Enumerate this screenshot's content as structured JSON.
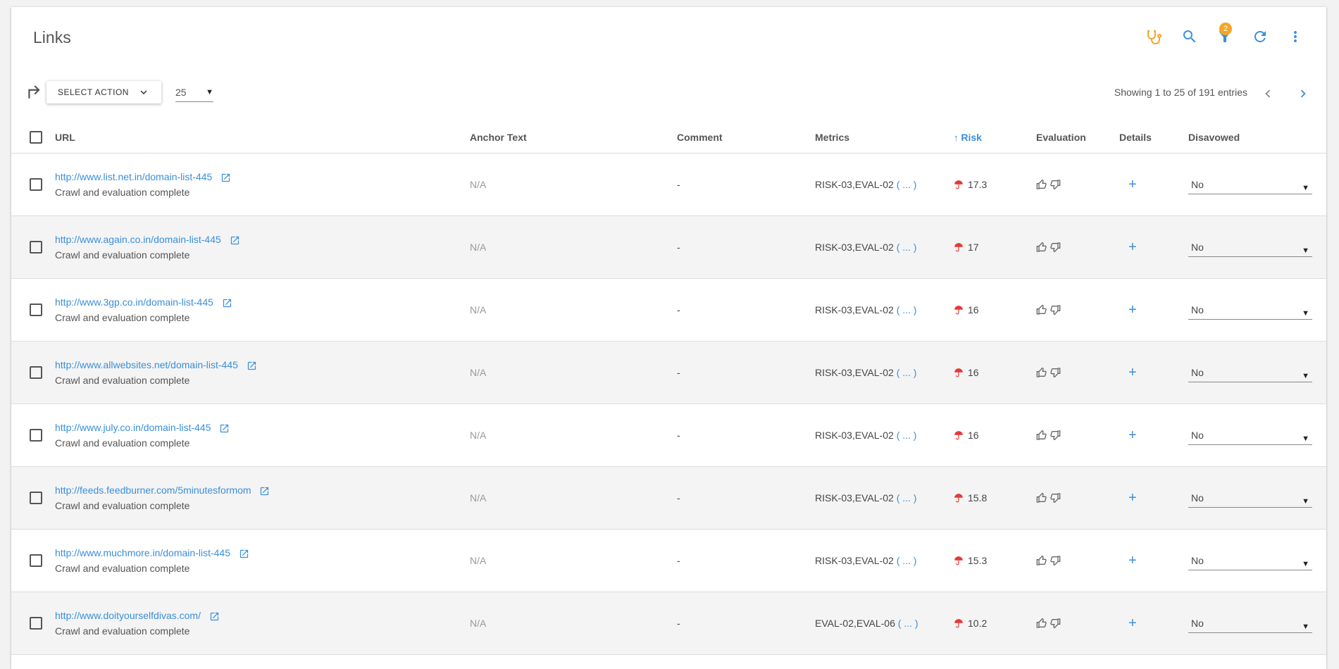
{
  "header": {
    "title": "Links",
    "filter_badge": "2"
  },
  "toolbar": {
    "select_action_label": "SELECT ACTION",
    "per_page": "25",
    "showing": "Showing 1 to 25 of 191 entries"
  },
  "table": {
    "columns": {
      "url": "URL",
      "anchor": "Anchor Text",
      "comment": "Comment",
      "metrics": "Metrics",
      "risk": "Risk",
      "evaluation": "Evaluation",
      "details": "Details",
      "disavowed": "Disavowed"
    },
    "rows": [
      {
        "url": "http://www.list.net.in/domain-list-445",
        "status": "Crawl and evaluation complete",
        "anchor": "N/A",
        "comment": "-",
        "metrics": "RISK-03,EVAL-02",
        "more": "( ... )",
        "risk": "17.3",
        "details": "+",
        "disavowed": "No"
      },
      {
        "url": "http://www.again.co.in/domain-list-445",
        "status": "Crawl and evaluation complete",
        "anchor": "N/A",
        "comment": "-",
        "metrics": "RISK-03,EVAL-02",
        "more": "( ... )",
        "risk": "17",
        "details": "+",
        "disavowed": "No"
      },
      {
        "url": "http://www.3gp.co.in/domain-list-445",
        "status": "Crawl and evaluation complete",
        "anchor": "N/A",
        "comment": "-",
        "metrics": "RISK-03,EVAL-02",
        "more": "( ... )",
        "risk": "16",
        "details": "+",
        "disavowed": "No"
      },
      {
        "url": "http://www.allwebsites.net/domain-list-445",
        "status": "Crawl and evaluation complete",
        "anchor": "N/A",
        "comment": "-",
        "metrics": "RISK-03,EVAL-02",
        "more": "( ... )",
        "risk": "16",
        "details": "+",
        "disavowed": "No"
      },
      {
        "url": "http://www.july.co.in/domain-list-445",
        "status": "Crawl and evaluation complete",
        "anchor": "N/A",
        "comment": "-",
        "metrics": "RISK-03,EVAL-02",
        "more": "( ... )",
        "risk": "16",
        "details": "+",
        "disavowed": "No"
      },
      {
        "url": "http://feeds.feedburner.com/5minutesformom",
        "status": "Crawl and evaluation complete",
        "anchor": "N/A",
        "comment": "-",
        "metrics": "RISK-03,EVAL-02",
        "more": "( ... )",
        "risk": "15.8",
        "details": "+",
        "disavowed": "No"
      },
      {
        "url": "http://www.muchmore.in/domain-list-445",
        "status": "Crawl and evaluation complete",
        "anchor": "N/A",
        "comment": "-",
        "metrics": "RISK-03,EVAL-02",
        "more": "( ... )",
        "risk": "15.3",
        "details": "+",
        "disavowed": "No"
      },
      {
        "url": "http://www.doityourselfdivas.com/",
        "status": "Crawl and evaluation complete",
        "anchor": "N/A",
        "comment": "-",
        "metrics": "EVAL-02,EVAL-06",
        "more": "( ... )",
        "risk": "10.2",
        "details": "+",
        "disavowed": "No"
      }
    ]
  },
  "colors": {
    "accent": "#3a8fd9",
    "stethoscope": "#f5a623",
    "badge": "#f5a623",
    "risk_icon": "#e53935"
  }
}
